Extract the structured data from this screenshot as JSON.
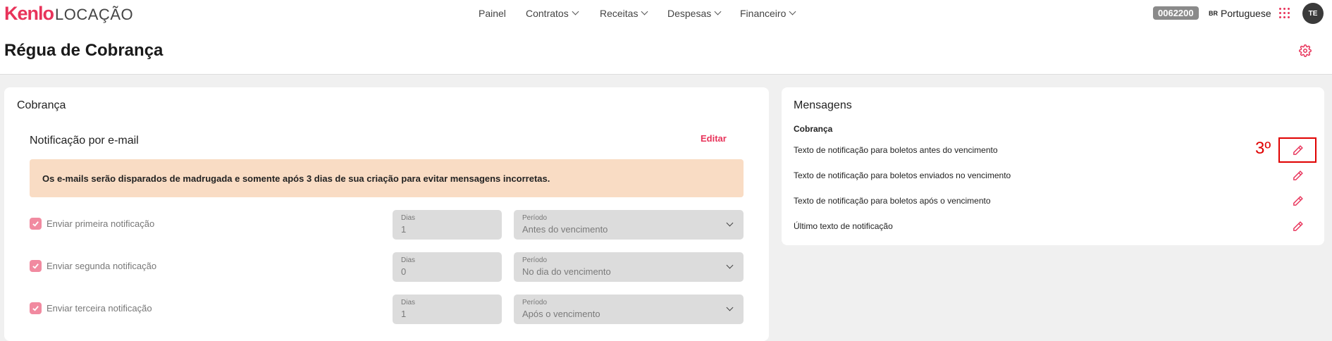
{
  "nav": {
    "logo_brand": "Kenlo",
    "logo_sub": "LOCAÇÃO",
    "items": [
      {
        "label": "Painel"
      },
      {
        "label": "Contratos"
      },
      {
        "label": "Receitas"
      },
      {
        "label": "Despesas"
      },
      {
        "label": "Financeiro"
      }
    ],
    "account_code": "0062200",
    "language_flag": "BR",
    "language": "Portuguese",
    "user_initials": "TE"
  },
  "header": {
    "title": "Régua de Cobrança"
  },
  "billing": {
    "title": "Cobrança",
    "section_title": "Notificação por e-mail",
    "edit_label": "Editar",
    "alert": "Os e-mails serão disparados de madrugada e somente após 3 dias de sua criação para evitar mensagens incorretas.",
    "rows": [
      {
        "label": "Enviar primeira notificação",
        "checked": true,
        "days_label": "Dias",
        "days": "1",
        "period_label": "Período",
        "period": "Antes do vencimento"
      },
      {
        "label": "Enviar segunda notificação",
        "checked": true,
        "days_label": "Dias",
        "days": "0",
        "period_label": "Período",
        "period": "No dia do vencimento"
      },
      {
        "label": "Enviar terceira notificação",
        "checked": true,
        "days_label": "Dias",
        "days": "1",
        "period_label": "Período",
        "period": "Após o vencimento"
      }
    ]
  },
  "messages": {
    "title": "Mensagens",
    "section": "Cobrança",
    "items": [
      {
        "label": "Texto de notificação para boletos antes do vencimento"
      },
      {
        "label": "Texto de notificação para boletos enviados no vencimento"
      },
      {
        "label": "Texto de notificação para boletos após o vencimento"
      },
      {
        "label": "Último texto de notificação"
      }
    ],
    "step_annotation": "3º"
  },
  "colors": {
    "accent": "#e8335a",
    "alert_bg": "#f9dcc4",
    "annotation": "#e00000",
    "page_bg": "#f0f0f0"
  }
}
